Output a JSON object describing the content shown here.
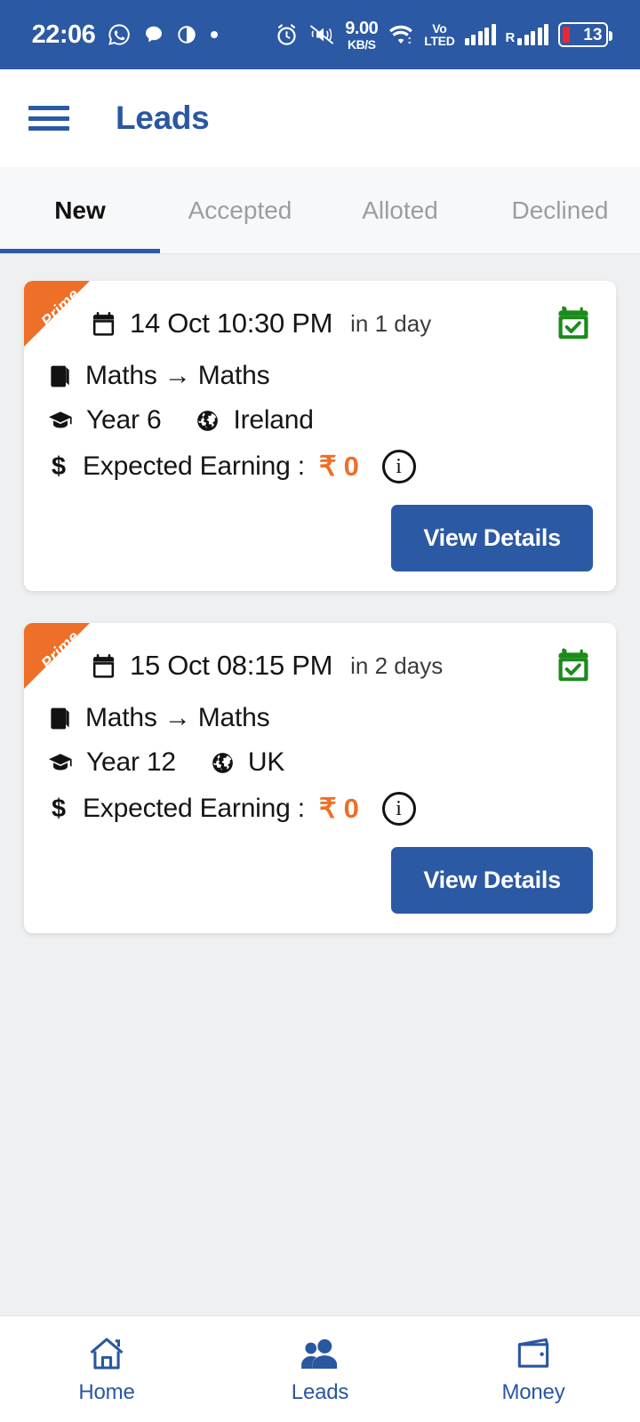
{
  "status_bar": {
    "time": "22:06",
    "network_speed_value": "9.00",
    "network_speed_unit": "KB/S",
    "volte_line1": "Vo",
    "volte_line2": "LTED",
    "roaming_label": "R",
    "battery_level": "13",
    "icons": [
      "whatsapp-icon",
      "message-icon",
      "contrast-icon",
      "dot-icon",
      "alarm-icon",
      "mute-icon",
      "wifi-icon",
      "volte-icon",
      "signal-icon",
      "roaming-signal-icon",
      "battery-icon"
    ],
    "background_color": "#2b59a3"
  },
  "app_bar": {
    "menu_icon": "hamburger-menu-icon",
    "title": "Leads",
    "title_color": "#2a57a0"
  },
  "tabs": {
    "items": [
      {
        "label": "New",
        "active": true
      },
      {
        "label": "Accepted",
        "active": false
      },
      {
        "label": "Alloted",
        "active": false
      },
      {
        "label": "Declined",
        "active": false
      }
    ],
    "active_indicator_color": "#2b59a3"
  },
  "leads": [
    {
      "badge": "Prime",
      "date": "14 Oct 10:30 PM",
      "relative": "in 1 day",
      "subject_from": "Maths",
      "subject_arrow": "→",
      "subject_to": "Maths",
      "subject_line": "Maths → Maths",
      "year": "Year 6",
      "country": "Ireland",
      "earning_label": "Expected Earning :",
      "earning_amount": "₹ 0",
      "info_glyph": "i",
      "button_label": "View Details",
      "status_icon": "calendar-check-icon",
      "status_icon_color": "#1a8b1a"
    },
    {
      "badge": "Prime",
      "date": "15 Oct 08:15 PM",
      "relative": "in 2 days",
      "subject_from": "Maths",
      "subject_arrow": "→",
      "subject_to": "Maths",
      "subject_line": "Maths → Maths",
      "year": "Year 12",
      "country": "UK",
      "earning_label": "Expected Earning :",
      "earning_amount": "₹ 0",
      "info_glyph": "i",
      "button_label": "View Details",
      "status_icon": "calendar-check-icon",
      "status_icon_color": "#1a8b1a"
    }
  ],
  "bottom_nav": {
    "items": [
      {
        "label": "Home",
        "icon": "home-icon",
        "active": false
      },
      {
        "label": "Leads",
        "icon": "people-icon",
        "active": true
      },
      {
        "label": "Money",
        "icon": "wallet-icon",
        "active": false
      }
    ],
    "color": "#2a57a0"
  },
  "colors": {
    "brand_blue": "#2b59a3",
    "accent_orange": "#ee6f27",
    "success_green": "#1a8b1a",
    "page_background": "#eff0f1",
    "card_background": "#ffffff"
  }
}
